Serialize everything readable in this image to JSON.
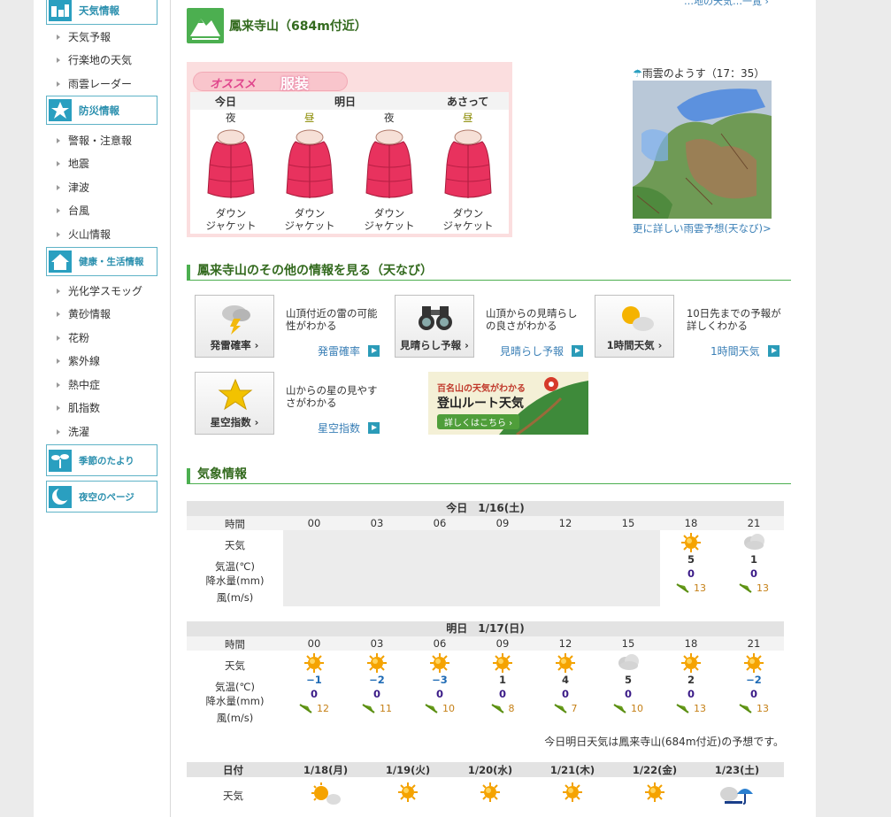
{
  "sidebar": {
    "sections": [
      {
        "title": "天気情報",
        "icon": "weather-icon",
        "items": [
          "天気予報",
          "行楽地の天気",
          "雨雲レーダー"
        ]
      },
      {
        "title": "防災情報",
        "icon": "disaster-icon",
        "items": [
          "警報・注意報",
          "地震",
          "津波",
          "台風",
          "火山情報"
        ]
      },
      {
        "title": "健康・生活情報",
        "icon": "home-icon",
        "items": [
          "光化学スモッグ",
          "黄砂情報",
          "花粉",
          "紫外線",
          "熱中症",
          "肌指数",
          "洗濯"
        ]
      },
      {
        "title": "季節のたより",
        "icon": "sprout-icon",
        "items": []
      },
      {
        "title": "夜空のページ",
        "icon": "moon-icon",
        "items": []
      }
    ]
  },
  "header": {
    "title": "鳳来寺山（684m付近）",
    "top_link": "…地の天気…一覧 ›"
  },
  "clothing": {
    "osusume": "オススメ",
    "fukuso": "服装",
    "days": [
      "今日",
      "明日",
      "あさって"
    ],
    "columns": [
      {
        "period": "夜",
        "name1": "ダウン",
        "name2": "ジャケット"
      },
      {
        "period": "昼",
        "name1": "ダウン",
        "name2": "ジャケット"
      },
      {
        "period": "夜",
        "name1": "ダウン",
        "name2": "ジャケット"
      },
      {
        "period": "昼",
        "name1": "ダウン",
        "name2": "ジャケット"
      }
    ]
  },
  "radar": {
    "title": "雨雲のようす（17：35）",
    "link": "更に詳しい雨雲予想(天なび)>"
  },
  "other_info": {
    "heading": "鳳来寺山のその他の情報を見る（天なび）",
    "items": [
      {
        "button": "発雷確率 ›",
        "desc": "山頂付近の雷の可能性がわかる",
        "link": "発雷確率"
      },
      {
        "button": "見晴らし予報 ›",
        "desc": "山頂からの見晴らしの良さがわかる",
        "link": "見晴らし予報"
      },
      {
        "button": "1時間天気 ›",
        "desc": "10日先までの予報が詳しくわかる",
        "link": "1時間天気"
      },
      {
        "button": "星空指数 ›",
        "desc": "山からの星の見やすさがわかる",
        "link": "星空指数"
      }
    ],
    "banner": {
      "line1": "百名山の天気がわかる",
      "line2": "登山ルート天気",
      "line3": "詳しくはこちら ›"
    }
  },
  "weather": {
    "heading": "気象情報",
    "labels": {
      "time": "時間",
      "weather": "天気",
      "temp": "気温(℃)",
      "rain": "降水量(mm)",
      "wind": "風(m/s)"
    },
    "hours": [
      "00",
      "03",
      "06",
      "09",
      "12",
      "15",
      "18",
      "21"
    ],
    "today": {
      "date": "今日　1/16(土)",
      "cols": [
        {
          "icon": "sun-icon",
          "temp": "5",
          "rain": "0",
          "wind": "13"
        },
        {
          "icon": "cloud-icon",
          "temp": "1",
          "rain": "0",
          "wind": "13"
        }
      ]
    },
    "tomorrow": {
      "date": "明日　1/17(日)",
      "cols": [
        {
          "icon": "sun-icon",
          "temp": "-1",
          "rain": "0",
          "wind": "12"
        },
        {
          "icon": "sun-icon",
          "temp": "-2",
          "rain": "0",
          "wind": "11"
        },
        {
          "icon": "sun-icon",
          "temp": "-3",
          "rain": "0",
          "wind": "10"
        },
        {
          "icon": "sun-icon",
          "temp": "1",
          "rain": "0",
          "wind": "8"
        },
        {
          "icon": "sun-icon",
          "temp": "4",
          "rain": "0",
          "wind": "7"
        },
        {
          "icon": "cloud-icon",
          "temp": "5",
          "rain": "0",
          "wind": "10"
        },
        {
          "icon": "sun-icon",
          "temp": "2",
          "rain": "0",
          "wind": "13"
        },
        {
          "icon": "sun-icon",
          "temp": "-2",
          "rain": "0",
          "wind": "13"
        }
      ]
    },
    "note": "今日明日天気は鳳来寺山(684m付近)の予想です。"
  },
  "weekly": {
    "date_label": "日付",
    "weather_label": "天気",
    "days": [
      {
        "date": "1/18(月)",
        "icon": "sun-cloud-icon"
      },
      {
        "date": "1/19(火)",
        "icon": "sun-icon"
      },
      {
        "date": "1/20(水)",
        "icon": "sun-icon"
      },
      {
        "date": "1/21(木)",
        "icon": "sun-icon"
      },
      {
        "date": "1/22(金)",
        "icon": "sun-icon"
      },
      {
        "date": "1/23(土)",
        "icon": "cloud-umbrella-icon"
      }
    ]
  },
  "colors": {
    "accent": "#4caf50",
    "link": "#3a7fb6",
    "sidebar_accent": "#2a9fc0"
  }
}
